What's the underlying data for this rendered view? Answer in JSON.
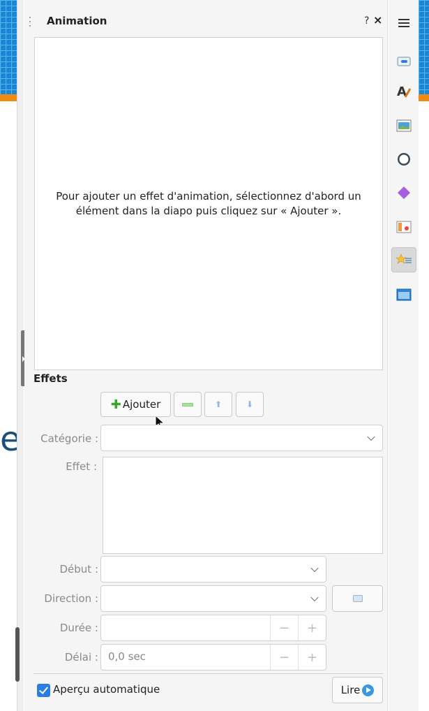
{
  "slide_fragment": {
    "letter": "e"
  },
  "panel": {
    "title": "Animation",
    "help": "?",
    "close": "×",
    "empty_message": "Pour ajouter un effet d'animation, sélectionnez d'abord un élément dans la diapo puis cliquez sur « Ajouter ».",
    "effects_heading": "Effets",
    "add_label": "Ajouter",
    "fields": {
      "category_label": "Catégorie :",
      "category_value": "",
      "effect_label": "Effet :",
      "start_label": "Début :",
      "start_value": "",
      "direction_label": "Direction :",
      "direction_value": "",
      "duration_label": "Durée :",
      "duration_value": "",
      "delay_label": "Délai :",
      "delay_value": "0,0 sec",
      "minus": "−",
      "plus": "+"
    },
    "autopreview_label": "Aperçu automatique",
    "autopreview_checked": true,
    "play_label": "Lire"
  },
  "sidebar": {
    "items": [
      {
        "icon": "menu-icon"
      },
      {
        "icon": "properties-icon"
      },
      {
        "icon": "styles-icon"
      },
      {
        "icon": "gallery-icon"
      },
      {
        "icon": "navigator-icon"
      },
      {
        "icon": "shapes-icon"
      },
      {
        "icon": "slide-transition-icon"
      },
      {
        "icon": "animation-icon",
        "active": true
      },
      {
        "icon": "master-slides-icon"
      }
    ]
  },
  "colors": {
    "accent": "#2b7de1",
    "add_plus": "#3aa62e",
    "slide_blue": "#1a86d6",
    "slide_orange": "#ef8a12"
  }
}
